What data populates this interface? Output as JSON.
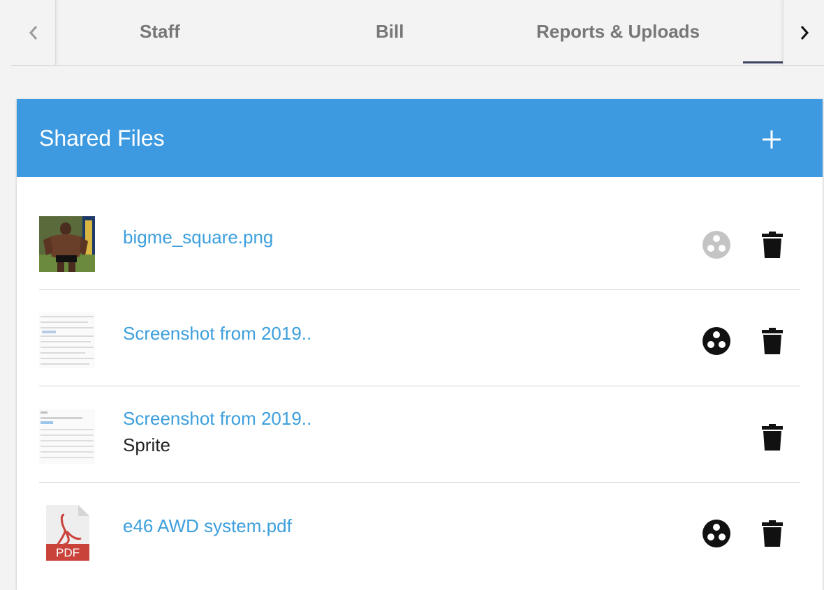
{
  "tabs": {
    "items": [
      {
        "label": "Staff"
      },
      {
        "label": "Bill"
      },
      {
        "label": "Reports & Uploads"
      }
    ],
    "active_index": 3
  },
  "card": {
    "title": "Shared Files",
    "add_icon": "plus-icon"
  },
  "files": [
    {
      "name": "bigme_square.png",
      "subtitle": "",
      "thumb": "photo-thumbnail",
      "share_state": "disabled"
    },
    {
      "name": "Screenshot from 2019..",
      "subtitle": "",
      "thumb": "screenshot-thumbnail",
      "share_state": "active"
    },
    {
      "name": "Screenshot from 2019..",
      "subtitle": "Sprite",
      "thumb": "screenshot-thumbnail",
      "share_state": "none"
    },
    {
      "name": "e46 AWD system.pdf",
      "subtitle": "",
      "thumb": "pdf-icon",
      "thumb_label": "PDF",
      "share_state": "active"
    }
  ],
  "colors": {
    "header_bg": "#3d99e0",
    "link": "#3d9fdc",
    "tab_text": "#777777",
    "tab_indicator": "#3b4260",
    "share_disabled": "#c4c4c4",
    "icon_dark": "#111111",
    "pdf_red": "#c9433b"
  }
}
